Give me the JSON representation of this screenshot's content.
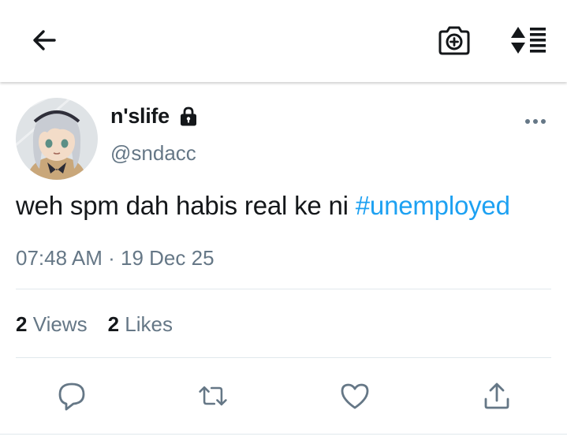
{
  "header": {
    "back_icon": "arrow-left-icon",
    "camera_icon": "camera-plus-icon",
    "sort_icon": "sort-toggle-icon"
  },
  "tweet": {
    "display_name": "n'slife",
    "handle": "@sndacc",
    "text_plain": "weh spm dah habis real ke ni ",
    "hashtag": "#unemployed",
    "time": "07:48 AM",
    "separator": "·",
    "date": "19 Dec 25",
    "stats": {
      "views_count": "2",
      "views_label": "Views",
      "likes_count": "2",
      "likes_label": "Likes"
    },
    "actions": [
      "reply-icon",
      "retweet-icon",
      "like-icon",
      "share-icon"
    ]
  },
  "colors": {
    "link": "#1da1f2",
    "secondary_text": "#657786",
    "primary_text": "#14171a",
    "divider": "#e1e8ed"
  }
}
